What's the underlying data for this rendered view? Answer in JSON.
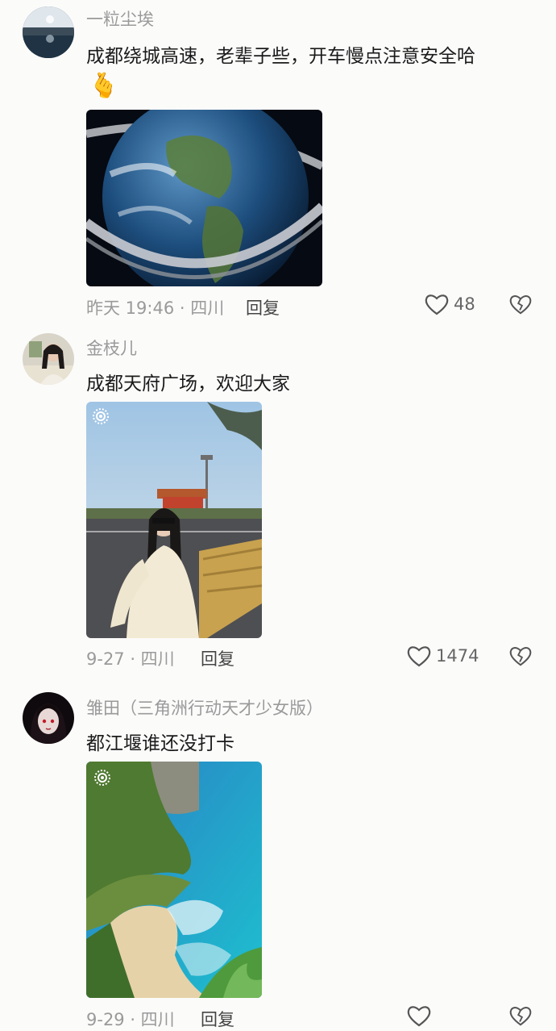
{
  "comments": [
    {
      "username": "一粒尘埃",
      "text": "成都绕城高速，老辈子些，开车慢点注意安全哈",
      "emoji": "🫰",
      "time": "昨天 19:46",
      "location": "四川",
      "meta": "昨天 19:46 · 四川",
      "reply_label": "回复",
      "likes": "48"
    },
    {
      "username": "金枝儿",
      "text": "成都天府广场，欢迎大家",
      "time": "9-27",
      "location": "四川",
      "meta": "9-27 · 四川",
      "reply_label": "回复",
      "likes": "1474"
    },
    {
      "username": "雏田（三角洲行动天才少女版）",
      "text": "都江堰谁还没打卡",
      "time": "9-29",
      "location": "四川",
      "meta": "9-29 · 四川",
      "reply_label": "回复",
      "likes": ""
    }
  ],
  "icons": {
    "like": "heart-outline-icon",
    "dislike": "broken-heart-icon",
    "live": "live-photo-icon"
  },
  "colors": {
    "background": "#fbfbfa",
    "meta_text": "#9a9a9a",
    "body_text": "#1b1b1b"
  }
}
